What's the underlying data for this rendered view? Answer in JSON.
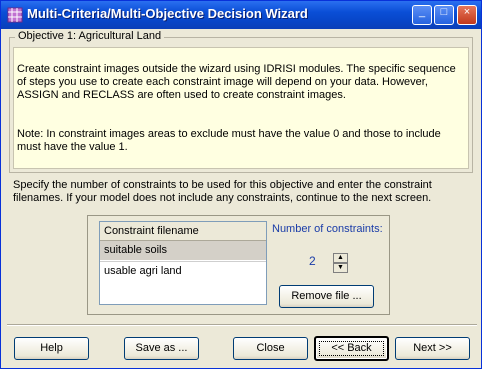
{
  "window": {
    "title": "Multi-Criteria/Multi-Objective Decision Wizard",
    "controls": {
      "minimize": "_",
      "maximize": "□",
      "close": "×"
    }
  },
  "objective": {
    "label": "Objective 1: Agricultural Land",
    "note_paragraph_1": "Create constraint images outside the wizard using IDRISI modules. The specific sequence of steps you use to create each constraint image will depend on your data. However, ASSIGN and RECLASS are often used to create constraint images.",
    "note_paragraph_2": "Note: In constraint images areas to exclude must have the value 0 and those to include must have the value 1."
  },
  "instructions": "Specify the number of constraints to be used for this objective and enter the constraint filenames. If your model does not include any constraints, continue to the next screen.",
  "constraints": {
    "column_header": "Constraint filename",
    "rows": [
      "suitable soils",
      "usable agri land"
    ],
    "count_label": "Number of constraints:",
    "count_value": "2",
    "spin_up": "▲",
    "spin_down": "▼",
    "remove_button": "Remove file ..."
  },
  "buttons": {
    "help": "Help",
    "save_as": "Save as ...",
    "close": "Close",
    "back": "<< Back",
    "next": "Next >>"
  },
  "colors": {
    "titlebar": "#0a4ed6",
    "note_background": "#ffffe1",
    "selected_row": "#d4d0c8",
    "label_blue": "#1a3ca8"
  }
}
